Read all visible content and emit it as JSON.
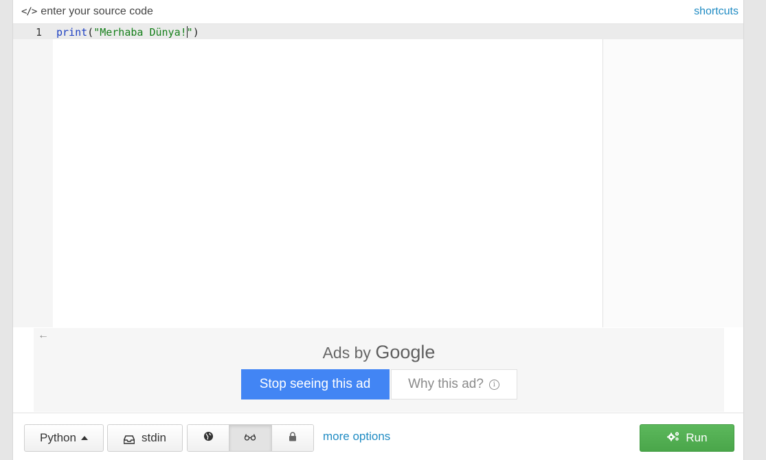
{
  "header": {
    "code_icon": "</>",
    "label": "enter your source code",
    "shortcuts": "shortcuts"
  },
  "editor": {
    "line_number": "1",
    "code_keyword": "print",
    "code_open_paren": "(",
    "code_string_before_cursor": "\"Merhaba Dünya!",
    "code_string_after_cursor": "\"",
    "code_close_paren": ")"
  },
  "ad": {
    "back_arrow": "←",
    "ads_by": "Ads by",
    "google": "Google",
    "stop_label": "Stop seeing this ad",
    "why_label": "Why this ad?",
    "info_glyph": "i"
  },
  "toolbar": {
    "language": "Python",
    "stdin": "stdin",
    "more_options": "more options",
    "run": "Run",
    "active_mode": "glasses-icon"
  },
  "colors": {
    "accent_link": "#1f8bc3",
    "run_green": "#5cb85c",
    "ad_blue": "#4285f4",
    "keyword": "#1c3fc2",
    "string": "#157f1a"
  }
}
